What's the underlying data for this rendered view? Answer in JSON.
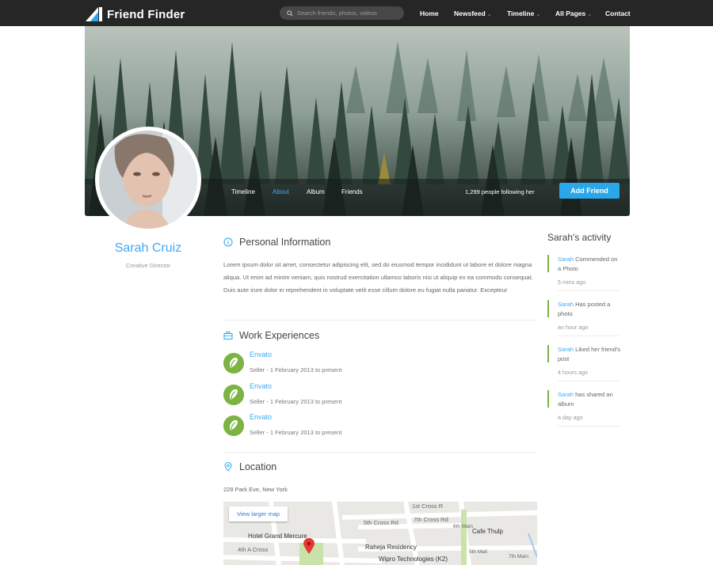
{
  "app": {
    "logo_text": "Friend Finder",
    "search_placeholder": "Search friends, photos, videos"
  },
  "nav": {
    "home": "Home",
    "newsfeed": "Newsfeed",
    "timeline": "Timeline",
    "all_pages": "All Pages",
    "contact": "Contact"
  },
  "profile": {
    "name": "Sarah Cruiz",
    "role": "Creative Director",
    "tabs": [
      "Timeline",
      "About",
      "Album",
      "Friends"
    ],
    "active_tab": "About",
    "followers_text": "1,299 people following her",
    "add_friend_label": "Add Friend"
  },
  "about": {
    "personal_title": "Personal Information",
    "personal_text": "Lorem ipsum dolor sit amet, consectetur adipiscing elit, sed do eiusmod tempor incididunt ut labore et dolore magna aliqua. Ut enim ad minim veniam, quis nostrud exercitation ullamco laboris nisi ut aliquip ex ea commodo consequat. Duis aute irure dolor in reprehendent in voluptate velit esse cillum dolore eu fugiat nulla pariatur. Excepteur",
    "work_title": "Work Experiences",
    "work": [
      {
        "company": "Envato",
        "detail": "Seller - 1 February 2013 to present"
      },
      {
        "company": "Envato",
        "detail": "Seller - 1 February 2013 to present"
      },
      {
        "company": "Envato",
        "detail": "Seller - 1 February 2013 to present"
      }
    ],
    "location_title": "Location",
    "address": "228 Park Eve, New York",
    "map": {
      "larger_map_label": "View larger map",
      "labels": {
        "hotel": "Hotel Grand Mercure",
        "raheja": "Raheja Residency",
        "wipro": "Wipro Technologies (K2)",
        "cafe": "Cafe Thulp",
        "cross7": "7th Cross Rd",
        "cross5": "5th Cross Rd",
        "cross1": "1st Cross R",
        "cross4": "4th A Cross",
        "main6": "6th Main",
        "main5": "5th Mail",
        "main7": "7th Main"
      }
    }
  },
  "activity": {
    "title": "Sarah's activity",
    "items": [
      {
        "who": "Sarah",
        "action": " Commended on a Photo",
        "time": "5 mins ago"
      },
      {
        "who": "Sarah",
        "action": " Has posted a photo",
        "time": "an hour ago"
      },
      {
        "who": "Sarah",
        "action": " Liked her friend's post",
        "time": "4 hours ago"
      },
      {
        "who": "Sarah",
        "action": " has shared an album",
        "time": "a day ago"
      }
    ]
  },
  "colors": {
    "accent": "#2aa7e8",
    "link": "#3fa9f5",
    "navbar": "#262626",
    "activity_bar": "#7cb342",
    "envato_green": "#7cb342"
  },
  "icons": [
    "search-icon",
    "chevron-down-icon",
    "info-icon",
    "briefcase-icon",
    "location-pin-icon",
    "map-marker-icon"
  ]
}
